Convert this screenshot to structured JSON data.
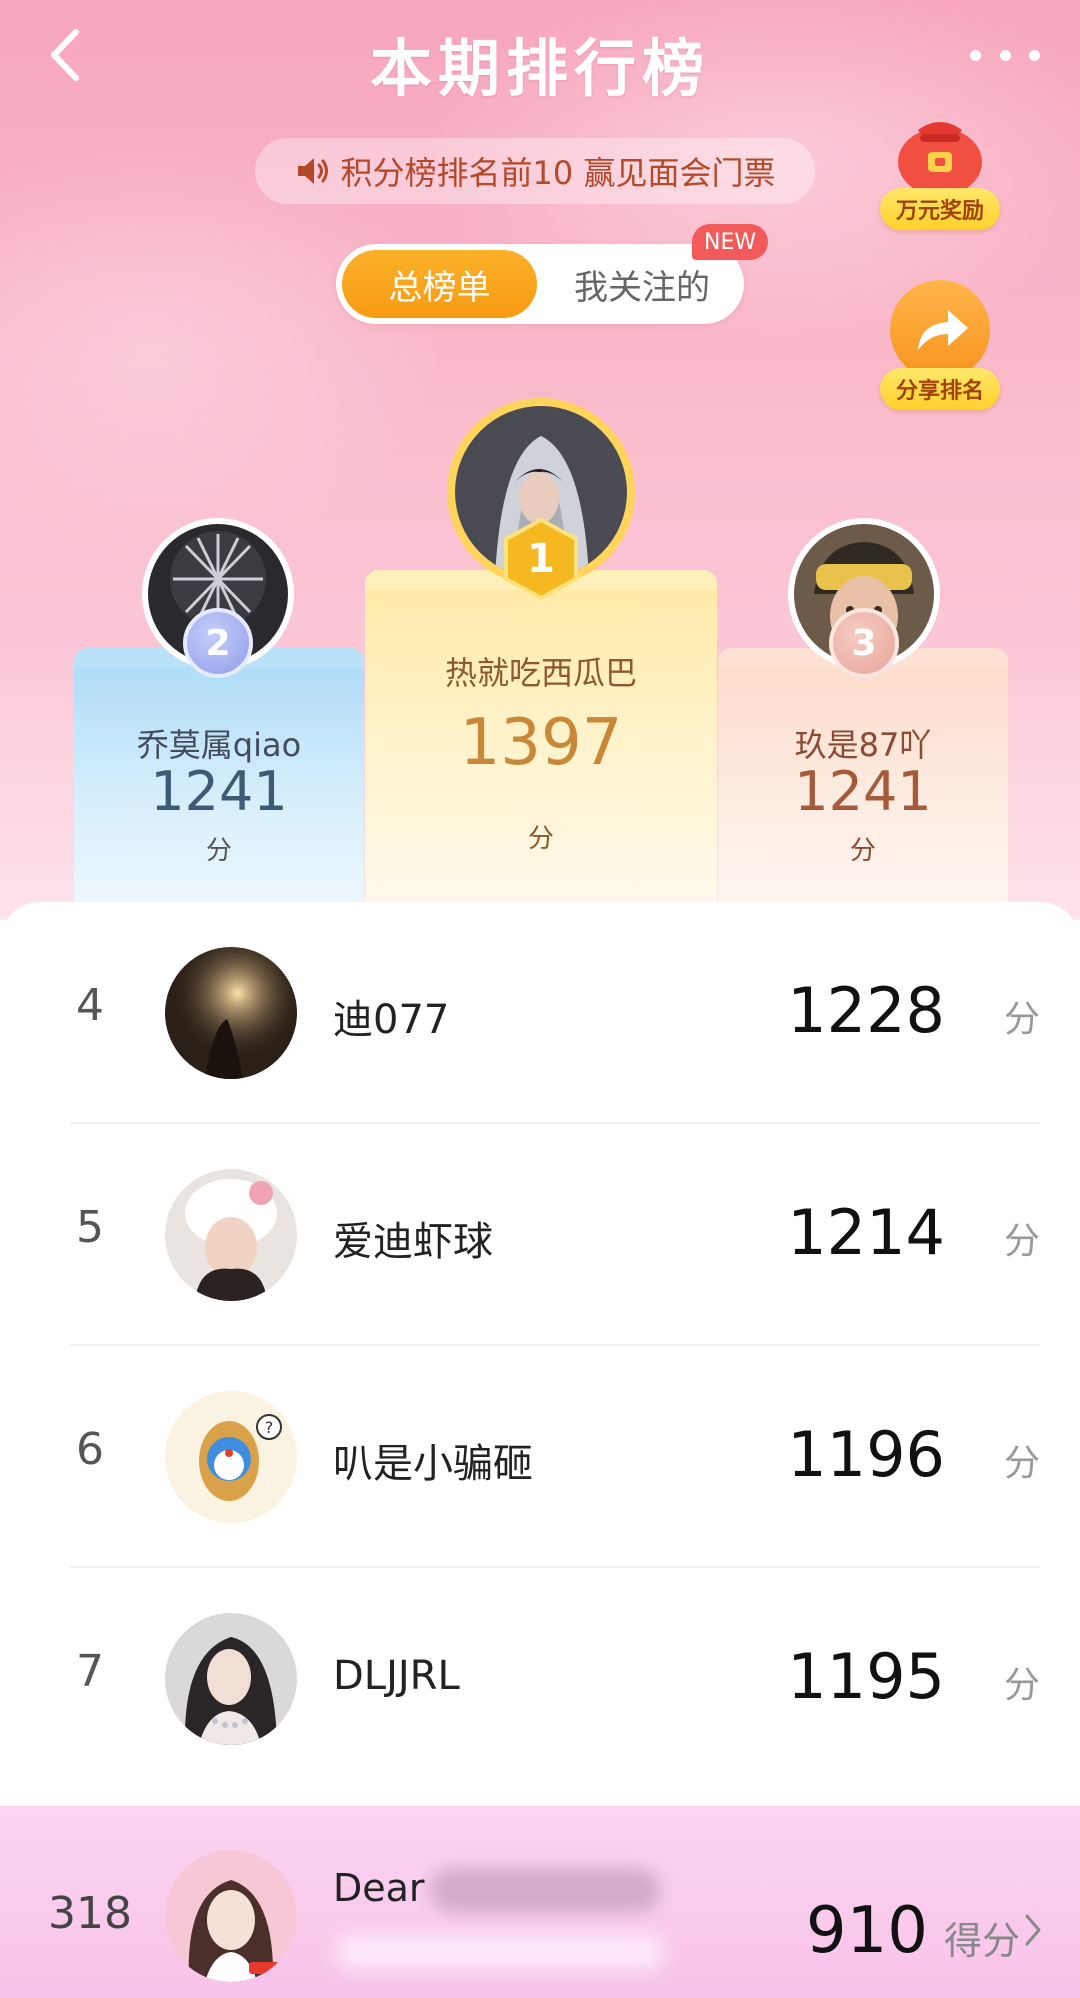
{
  "nav": {
    "title": "本期排行榜",
    "back_icon": "chevron-left-icon",
    "more_icon": "more-dots-icon"
  },
  "notice": {
    "icon": "speaker-icon",
    "text": "积分榜排名前10 赢见面会门票"
  },
  "tabs": {
    "active": "总榜单",
    "follow": "我关注的",
    "new_badge": "NEW"
  },
  "side_buttons": {
    "reward": {
      "label": "万元奖励",
      "icon": "money-bag-icon"
    },
    "share": {
      "label": "分享排名",
      "icon": "share-arrow-icon"
    }
  },
  "podium": {
    "first": {
      "rank": "1",
      "name": "热就吃西瓜巴",
      "score": "1397",
      "unit": "分"
    },
    "second": {
      "rank": "2",
      "name": "乔莫属qiao",
      "score": "1241",
      "unit": "分"
    },
    "third": {
      "rank": "3",
      "name": "玖是87吖",
      "score": "1241",
      "unit": "分"
    }
  },
  "list": [
    {
      "rank": "4",
      "name": "迪077",
      "score": "1228",
      "unit": "分"
    },
    {
      "rank": "5",
      "name": "爱迪虾球",
      "score": "1214",
      "unit": "分"
    },
    {
      "rank": "6",
      "name": "叭是小骗砸",
      "score": "1196",
      "unit": "分"
    },
    {
      "rank": "7",
      "name": "DLJJRL",
      "score": "1195",
      "unit": "分"
    }
  ],
  "me": {
    "rank": "318",
    "name": "Dear",
    "score": "910",
    "unit": "得分"
  },
  "colors": {
    "accent_orange": "#f79a12",
    "new_badge": "#f35b5b",
    "gold": "#f5b820",
    "silver_blue": "#8f9ee8",
    "bronze": "#e8a49a"
  }
}
